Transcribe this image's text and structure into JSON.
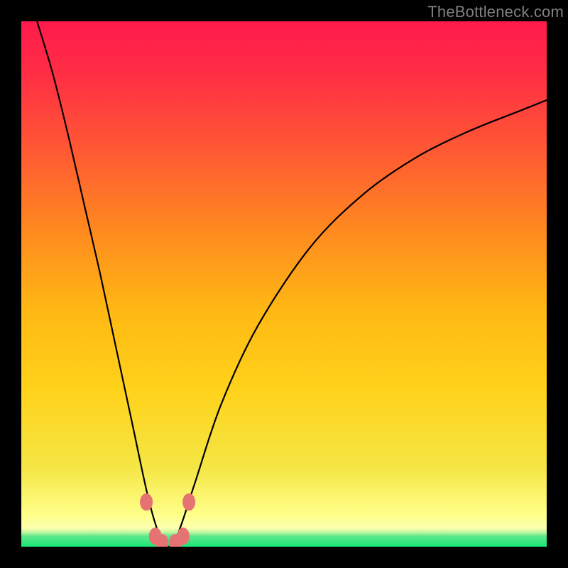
{
  "watermark": "TheBottleneck.com",
  "chart_data": {
    "type": "line",
    "title": "",
    "xlabel": "",
    "ylabel": "",
    "xlim": [
      0,
      1
    ],
    "ylim": [
      0,
      1
    ],
    "grid": false,
    "background_gradient": {
      "top_color": "#ff1a4d",
      "mid_color": "#ffd21a",
      "bottom_band_color": "#19e676",
      "bottom_band_height_fraction": 0.028
    },
    "series": [
      {
        "name": "bottleneck-curve",
        "description": "V-shaped curve descending steeply from upper-left to a narrow trough near x≈0.28, y≈0, then rising with decreasing slope toward the upper-right (asymptotic).",
        "x": [
          0.03,
          0.06,
          0.09,
          0.12,
          0.15,
          0.18,
          0.21,
          0.24,
          0.26,
          0.28,
          0.3,
          0.33,
          0.38,
          0.45,
          0.55,
          0.65,
          0.75,
          0.85,
          0.95,
          1.0
        ],
        "y": [
          1.0,
          0.9,
          0.78,
          0.65,
          0.52,
          0.38,
          0.24,
          0.1,
          0.03,
          0.0,
          0.03,
          0.12,
          0.27,
          0.42,
          0.57,
          0.67,
          0.74,
          0.79,
          0.83,
          0.85
        ]
      }
    ],
    "markers": {
      "name": "trough-markers",
      "description": "Small rounded salmon-colored markers near the trough of the curve on both sides and along the bottom.",
      "coordinates": [
        {
          "x": 0.238,
          "y": 0.085
        },
        {
          "x": 0.319,
          "y": 0.085
        },
        {
          "x": 0.255,
          "y": 0.02
        },
        {
          "x": 0.268,
          "y": 0.008
        },
        {
          "x": 0.293,
          "y": 0.008
        },
        {
          "x": 0.308,
          "y": 0.02
        }
      ],
      "color": "#e67373",
      "size": 9
    }
  }
}
